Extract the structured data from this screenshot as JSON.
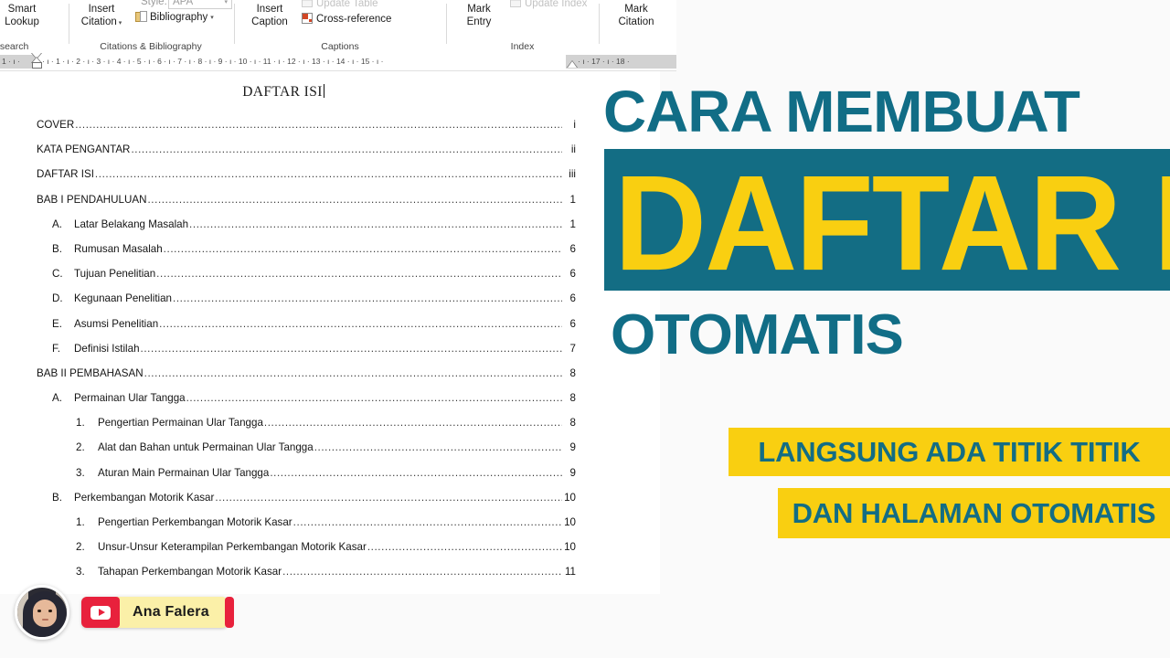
{
  "ribbon": {
    "groups": [
      {
        "caption": "",
        "buttons": [
          {
            "label": "Smart\nLookup"
          },
          {
            "label": "Research"
          }
        ]
      },
      {
        "caption": "Citations & Bibliography",
        "buttons": [
          {
            "label": "Insert\nCitation"
          },
          {
            "label": "Bibliography"
          }
        ],
        "style_label": "Style:",
        "style_value": "APA"
      },
      {
        "caption": "Captions",
        "buttons": [
          {
            "label": "Insert\nCaption"
          },
          {
            "label": "Cross-reference"
          }
        ],
        "disabled_label": "Update Table"
      },
      {
        "caption": "Index",
        "buttons": [
          {
            "label": "Mark\nEntry"
          }
        ],
        "disabled_label": "Update Index"
      },
      {
        "caption": "",
        "buttons": [
          {
            "label": "Mark\nCitation"
          }
        ]
      }
    ],
    "labels": {
      "smart_lookup": "Smart\nLookup",
      "smart_lookup_l1": "Smart",
      "smart_lookup_l2": "Lookup",
      "research": "esearch",
      "insert_citation_l1": "Insert",
      "insert_citation_l2": "Citation",
      "bibliography": "Bibliography",
      "style_label": "Style:",
      "style_value": "APA",
      "insert_caption_l1": "Insert",
      "insert_caption_l2": "Caption",
      "cross_reference": "Cross-reference",
      "update_table": "Update Table",
      "mark_entry_l1": "Mark",
      "mark_entry_l2": "Entry",
      "update_index": "Update Index",
      "mark_citation_l1": "Mark",
      "mark_citation_l2": "Citation",
      "group_citations": "Citations & Bibliography",
      "group_captions": "Captions",
      "group_index": "Index"
    }
  },
  "ruler": {
    "marks_left": "1 · ı · ",
    "marks_right": " · ı · 1 · ı · 2 · ı · 3 · ı · 4 · ı · 5 · ı · 6 · ı · 7 · ı · 8 · ı · 9 · ı · 10 · ı · 11 · ı · 12 · ı · 13 · ı · 14 · ı · 15 · ı ·",
    "marks_tail": " · ı · 17 · ı · 18 ·"
  },
  "document": {
    "title": "DAFTAR ISI",
    "toc": [
      {
        "num": "",
        "text": "COVER",
        "page": "i",
        "level": 0,
        "bold": false
      },
      {
        "num": "",
        "text": "KATA PENGANTAR",
        "page": "ii",
        "level": 0,
        "bold": false
      },
      {
        "num": "",
        "text": "DAFTAR ISI",
        "page": "iii",
        "level": 0,
        "bold": false
      },
      {
        "num": "",
        "text": "BAB I  PENDAHULUAN",
        "page": "1",
        "level": 0,
        "bold": false
      },
      {
        "num": "A.",
        "text": "Latar Belakang Masalah",
        "page": "1",
        "level": 1,
        "bold": false
      },
      {
        "num": "B.",
        "text": "Rumusan Masalah",
        "page": "6",
        "level": 1,
        "bold": false
      },
      {
        "num": "C.",
        "text": "Tujuan Penelitian",
        "page": "6",
        "level": 1,
        "bold": false
      },
      {
        "num": "D.",
        "text": "Kegunaan Penelitian",
        "page": "6",
        "level": 1,
        "bold": false
      },
      {
        "num": "E.",
        "text": "Asumsi Penelitian",
        "page": "6",
        "level": 1,
        "bold": false
      },
      {
        "num": "F.",
        "text": "Definisi Istilah",
        "page": "7",
        "level": 1,
        "bold": false
      },
      {
        "num": "",
        "text": "BAB II  PEMBAHASAN",
        "page": "8",
        "level": 0,
        "bold": false
      },
      {
        "num": "A.",
        "text": "Permainan Ular Tangga",
        "page": "8",
        "level": 1,
        "bold": false
      },
      {
        "num": "1.",
        "text": "Pengertian Permainan Ular Tangga",
        "page": "8",
        "level": 2,
        "bold": false
      },
      {
        "num": "2.",
        "text": "Alat dan Bahan untuk Permainan Ular Tangga",
        "page": "9",
        "level": 2,
        "bold": false
      },
      {
        "num": "3.",
        "text": "Aturan Main Permainan Ular Tangga",
        "page": "9",
        "level": 2,
        "bold": false
      },
      {
        "num": "B.",
        "text": "Perkembangan Motorik Kasar",
        "page": "10",
        "level": 1,
        "bold": false
      },
      {
        "num": "1.",
        "text": "Pengertian Perkembangan Motorik Kasar",
        "page": "10",
        "level": 2,
        "bold": false
      },
      {
        "num": "2.",
        "text": "Unsur-Unsur Keterampilan Perkembangan Motorik Kasar",
        "page": "10",
        "level": 2,
        "bold": false
      },
      {
        "num": "3.",
        "text": "Tahapan Perkembangan Motorik Kasar",
        "page": "11",
        "level": 2,
        "bold": false
      }
    ]
  },
  "overlay": {
    "heading_top": "CARA MEMBUAT",
    "heading_main": "DAFTAR ISI",
    "heading_bottom": "OTOMATIS",
    "banner_1": "LANGSUNG ADA TITIK TITIK",
    "banner_2": "DAN HALAMAN OTOMATIS",
    "colors": {
      "teal": "#136d84",
      "yellow": "#f9cf11"
    }
  },
  "branding": {
    "channel_name": "Ana Falera",
    "badge_color": "#e8213c",
    "pill_color": "#fbf0a8"
  }
}
